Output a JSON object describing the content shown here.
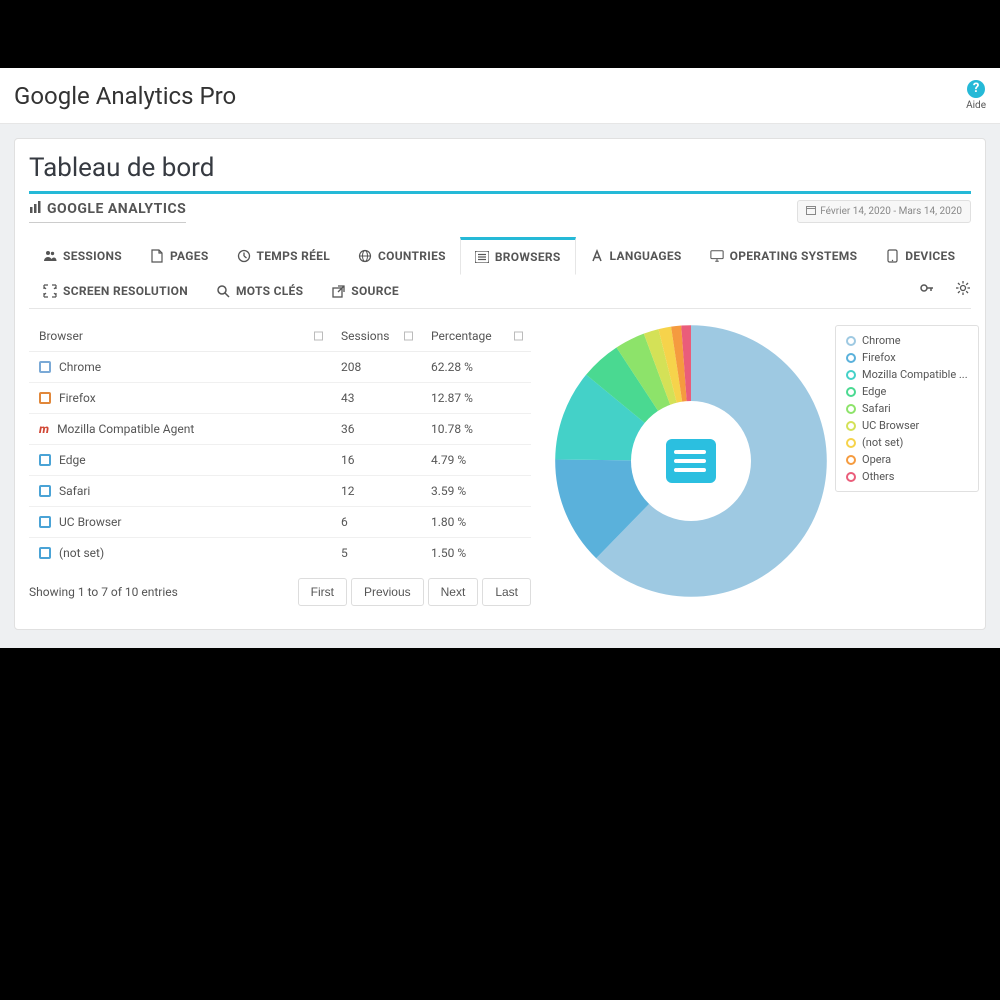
{
  "header": {
    "title": "Google Analytics Pro",
    "help_label": "Aide"
  },
  "panel": {
    "title": "Tableau de bord",
    "section_label": "GOOGLE ANALYTICS",
    "date_range": "Février 14, 2020 - Mars 14, 2020"
  },
  "tabs": [
    {
      "label": "SESSIONS",
      "icon": "users-icon"
    },
    {
      "label": "PAGES",
      "icon": "page-icon"
    },
    {
      "label": "TEMPS RÉEL",
      "icon": "clock-icon"
    },
    {
      "label": "COUNTRIES",
      "icon": "globe-icon"
    },
    {
      "label": "BROWSERS",
      "icon": "list-icon",
      "active": true
    },
    {
      "label": "LANGUAGES",
      "icon": "font-icon"
    },
    {
      "label": "OPERATING SYSTEMS",
      "icon": "desktop-icon"
    },
    {
      "label": "DEVICES",
      "icon": "tablet-icon"
    },
    {
      "label": "SCREEN RESOLUTION",
      "icon": "expand-icon"
    },
    {
      "label": "MOTS CLÉS",
      "icon": "search-icon"
    },
    {
      "label": "SOURCE",
      "icon": "external-icon"
    }
  ],
  "table": {
    "headers": [
      "Browser",
      "Sessions",
      "Percentage"
    ],
    "rows": [
      {
        "name": "Chrome",
        "sessions": "208",
        "percentage": "62.28 %",
        "color": "#7aa9d6"
      },
      {
        "name": "Firefox",
        "sessions": "43",
        "percentage": "12.87 %",
        "color": "#e1873a"
      },
      {
        "name": "Mozilla Compatible Agent",
        "sessions": "36",
        "percentage": "10.78 %",
        "color": "#d14836"
      },
      {
        "name": "Edge",
        "sessions": "16",
        "percentage": "4.79 %",
        "color": "#4aa3d6"
      },
      {
        "name": "Safari",
        "sessions": "12",
        "percentage": "3.59 %",
        "color": "#4aa3d6"
      },
      {
        "name": "UC Browser",
        "sessions": "6",
        "percentage": "1.80 %",
        "color": "#4aa3d6"
      },
      {
        "name": "(not set)",
        "sessions": "5",
        "percentage": "1.50 %",
        "color": "#4aa3d6"
      }
    ],
    "info": "Showing 1 to 7 of 10 entries",
    "pager": {
      "first": "First",
      "previous": "Previous",
      "next": "Next",
      "last": "Last"
    }
  },
  "chart_data": {
    "type": "pie",
    "title": "",
    "series": [
      {
        "name": "Chrome",
        "value": 62.28,
        "color": "#9ec9e2"
      },
      {
        "name": "Firefox",
        "value": 12.87,
        "color": "#5ab1db"
      },
      {
        "name": "Mozilla Compatible ...",
        "value": 10.78,
        "color": "#44d1c8"
      },
      {
        "name": "Edge",
        "value": 4.79,
        "color": "#4ad991"
      },
      {
        "name": "Safari",
        "value": 3.59,
        "color": "#8de36a"
      },
      {
        "name": "UC Browser",
        "value": 1.8,
        "color": "#d4e157"
      },
      {
        "name": "(not set)",
        "value": 1.5,
        "color": "#f6d34b"
      },
      {
        "name": "Opera",
        "value": 1.2,
        "color": "#f59b3f"
      },
      {
        "name": "Others",
        "value": 1.19,
        "color": "#ea5d7a"
      }
    ]
  }
}
